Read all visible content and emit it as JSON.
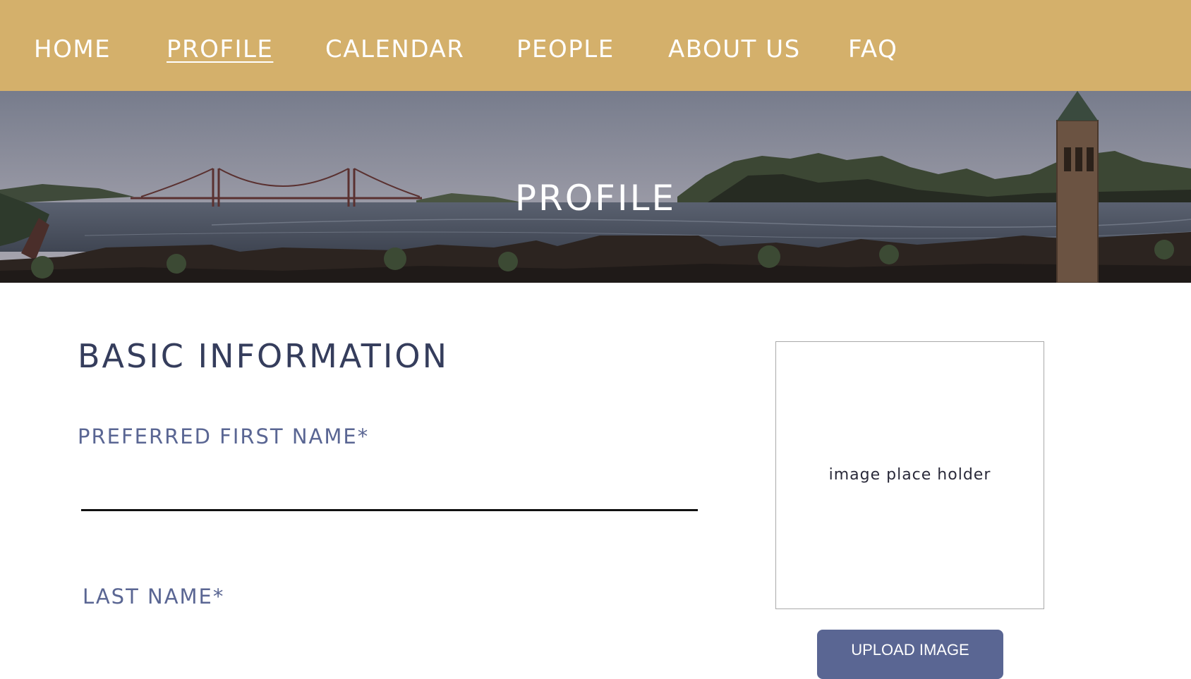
{
  "nav": {
    "items": [
      {
        "label": "HOME",
        "active": false
      },
      {
        "label": "PROFILE",
        "active": true
      },
      {
        "label": "CALENDAR",
        "active": false
      },
      {
        "label": "PEOPLE",
        "active": false
      },
      {
        "label": "ABOUT US",
        "active": false
      },
      {
        "label": "FAQ",
        "active": false
      }
    ]
  },
  "hero": {
    "title": "PROFILE"
  },
  "form": {
    "section_title": "BASIC INFORMATION",
    "first_name_label": "PREFERRED FIRST NAME*",
    "first_name_value": "",
    "last_name_label": "LAST NAME*",
    "last_name_value": ""
  },
  "photo": {
    "placeholder_text": "image place holder",
    "upload_label": "UPLOAD IMAGE"
  },
  "colors": {
    "nav_background": "#d4b06b",
    "heading": "#353d5c",
    "label": "#5a6693",
    "button": "#5a6693"
  }
}
